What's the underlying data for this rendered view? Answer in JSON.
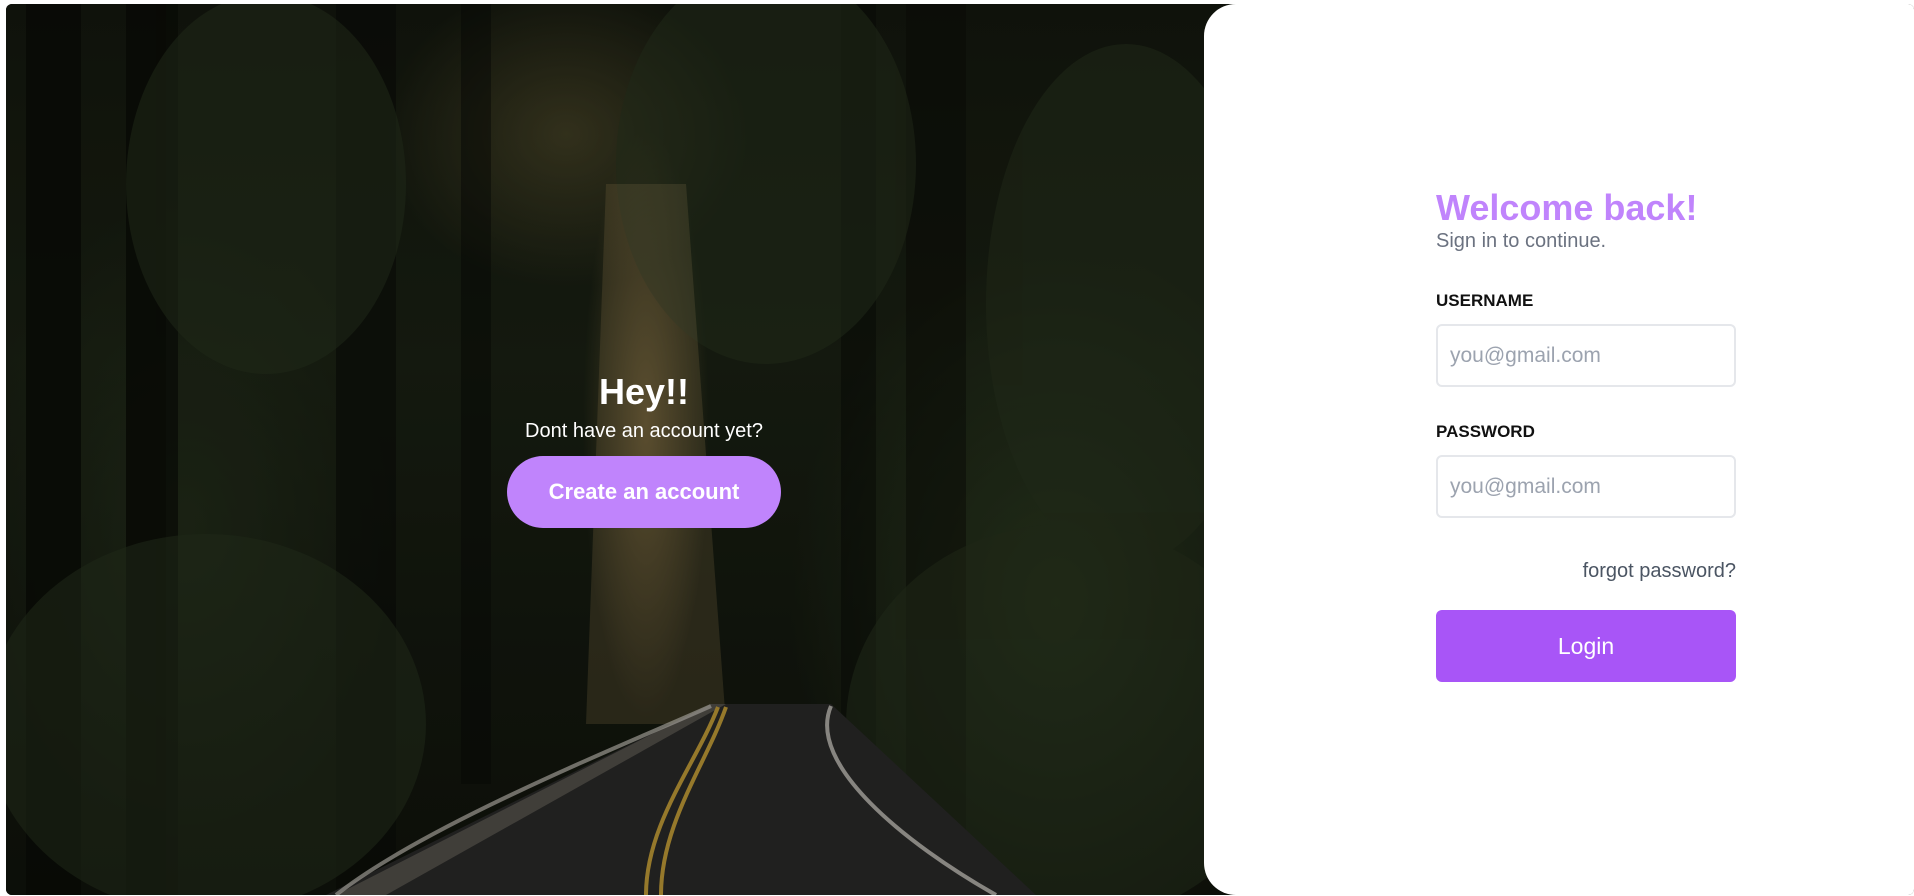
{
  "hero": {
    "title": "Hey!!",
    "subtitle": "Dont have an account yet?",
    "create_button": "Create an account"
  },
  "login": {
    "title": "Welcome back!",
    "subtitle": "Sign in to continue.",
    "username_label": "USERNAME",
    "username_placeholder": "you@gmail.com",
    "password_label": "PASSWORD",
    "password_placeholder": "you@gmail.com",
    "forgot_link": "forgot password?",
    "login_button": "Login"
  },
  "colors": {
    "accent_light": "#c084fc",
    "accent": "#a855f7",
    "muted_text": "#6b7280"
  }
}
